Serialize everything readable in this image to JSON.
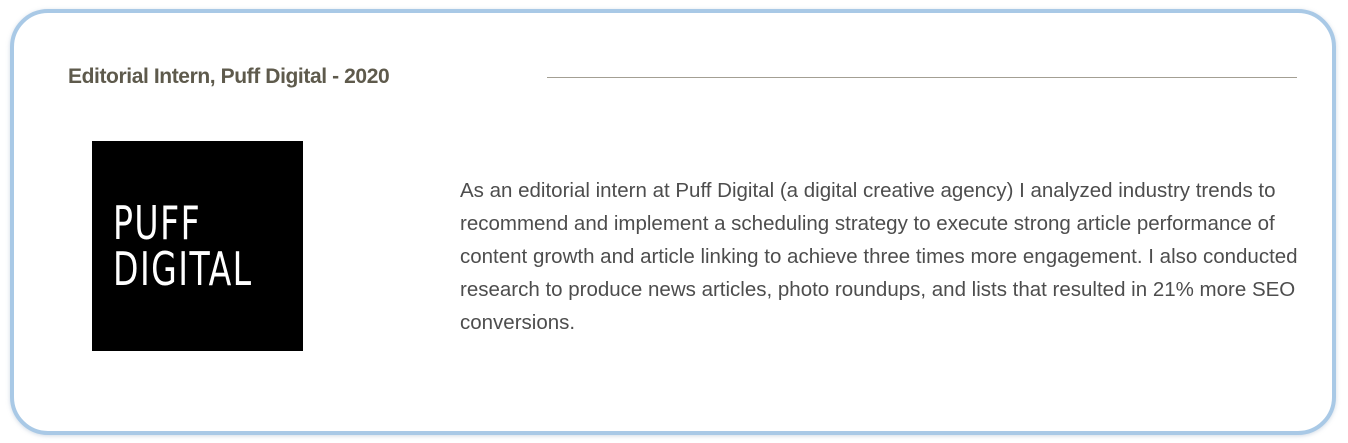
{
  "experience": {
    "title": "Editorial Intern, Puff Digital - 2020",
    "logo": {
      "line1": "PUFF",
      "line2": "DIGITAL"
    },
    "description": "As an editorial intern at Puff Digital (a digital creative agency) I analyzed industry trends to recommend and implement a scheduling strategy to execute strong article performance of content growth and article linking to achieve three times more engagement. I also conducted research to produce news articles, photo roundups, and lists that resulted in 21% more SEO conversions."
  },
  "colors": {
    "card_border": "#a9c9e6",
    "title_text": "#5e5a4c",
    "body_text": "#4d4d4d",
    "logo_background": "#000000",
    "logo_text": "#ffffff"
  }
}
